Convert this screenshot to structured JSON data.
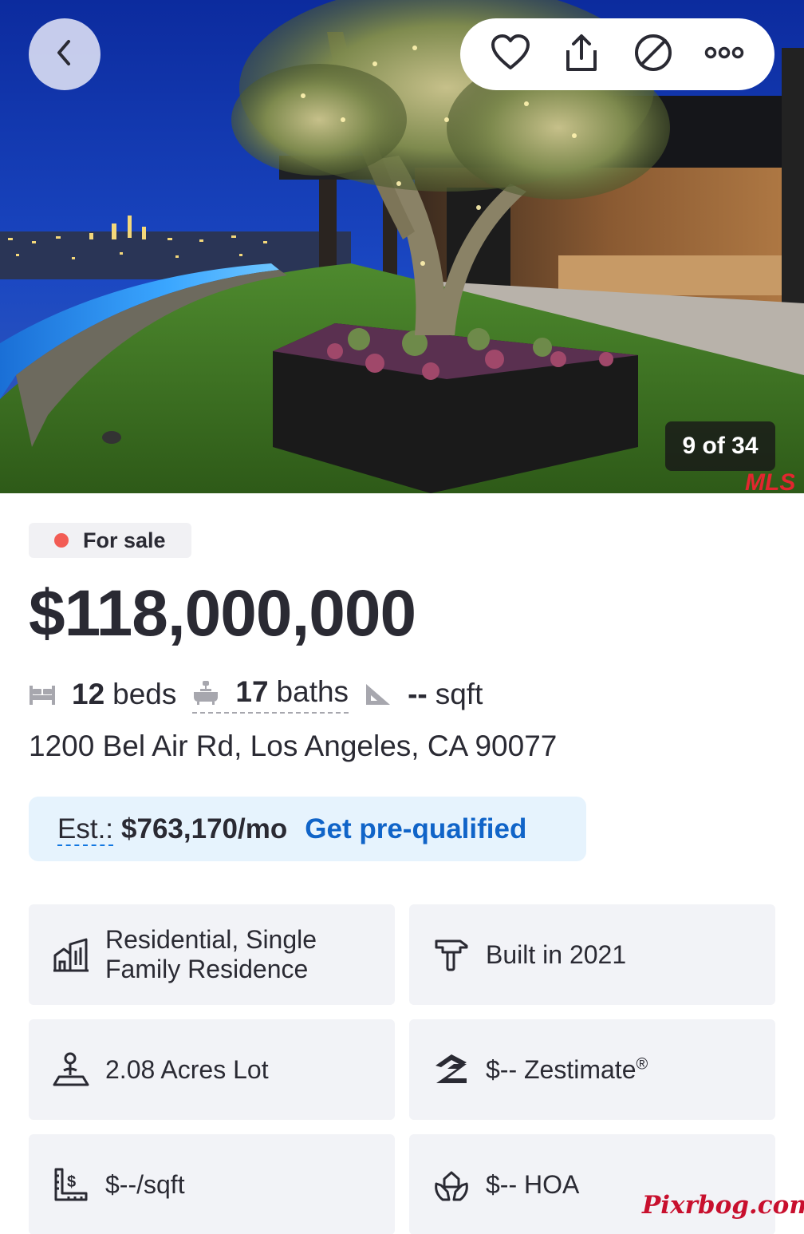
{
  "gallery": {
    "counter": "9 of 34",
    "back_icon": "chevron-left-icon",
    "actions": [
      {
        "name": "save",
        "icon": "heart-icon"
      },
      {
        "name": "share",
        "icon": "share-icon"
      },
      {
        "name": "hide",
        "icon": "hide-icon"
      },
      {
        "name": "more",
        "icon": "more-icon"
      }
    ],
    "mls_logo_text": "MLS"
  },
  "listing": {
    "status": "For sale",
    "status_color": "#f25c54",
    "price": "$118,000,000",
    "beds_value": "12",
    "beds_unit": "beds",
    "baths_value": "17",
    "baths_unit": "baths",
    "sqft_value": "--",
    "sqft_unit": "sqft",
    "address": "1200 Bel Air Rd, Los Angeles, CA 90077"
  },
  "estimate": {
    "label": "Est.:",
    "value": "$763,170/mo",
    "cta": "Get pre-qualified"
  },
  "facts_grid": {
    "type": {
      "icon": "building-icon",
      "line1": "Residential, Single",
      "line2": "Family Residence"
    },
    "built": {
      "icon": "hammer-icon",
      "text": "Built in 2021"
    },
    "lot": {
      "icon": "lot-icon",
      "text": "2.08 Acres Lot"
    },
    "zestimate": {
      "icon": "zillow-icon",
      "text": "$-- Zestimate",
      "mark": "®"
    },
    "price_sqft": {
      "icon": "price-per-sqft-icon",
      "text": "$--/sqft"
    },
    "hoa": {
      "icon": "hoa-icon",
      "text": "$-- HOA"
    }
  },
  "watermark": "Pixrbog.com",
  "colors": {
    "accent_blue": "#1064c8",
    "est_bg": "#e6f3fd",
    "card_bg": "#f2f3f7",
    "text": "#2a2a33"
  }
}
